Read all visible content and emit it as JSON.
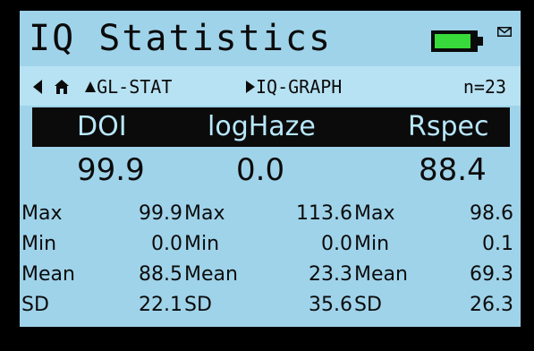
{
  "title": "IQ Statistics",
  "battery": {
    "level": 0.9,
    "color": "#38d93a"
  },
  "icons": {
    "battery": "battery-icon",
    "mail": "mail-icon",
    "back": "back-arrow-icon",
    "home": "home-icon",
    "up": "up-triangle-icon",
    "right": "right-triangle-icon"
  },
  "nav": {
    "left_label": "GL-STAT",
    "right_label": "IQ-GRAPH",
    "count": "n=23"
  },
  "columns": [
    {
      "header": "DOI",
      "value": "99.9"
    },
    {
      "header": "logHaze",
      "value": "0.0"
    },
    {
      "header": "Rspec",
      "value": "88.4"
    }
  ],
  "stats": [
    {
      "label": "Max",
      "values": [
        "99.9",
        "113.6",
        "98.6"
      ]
    },
    {
      "label": "Min",
      "values": [
        "0.0",
        "0.0",
        "0.1"
      ]
    },
    {
      "label": "Mean",
      "values": [
        "88.5",
        "23.3",
        "69.3"
      ]
    },
    {
      "label": "SD",
      "values": [
        "22.1",
        "35.6",
        "26.3"
      ]
    }
  ],
  "colors": {
    "screen_bg": "#9fd3ea",
    "nav_bg": "#b7e2f3",
    "header_bg": "#0b0b0b",
    "header_text": "#b8e7fa",
    "text": "#0b0b0b"
  }
}
